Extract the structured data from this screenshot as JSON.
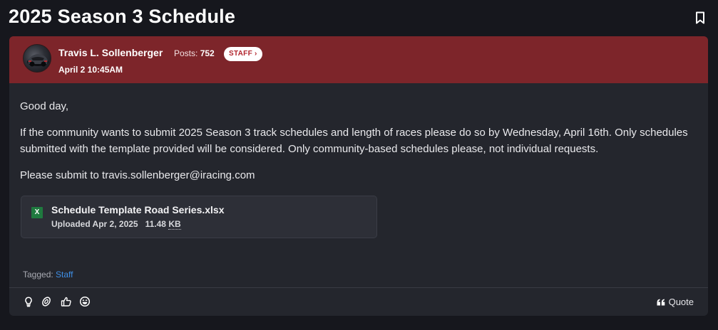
{
  "page": {
    "title": "2025 Season 3 Schedule"
  },
  "post": {
    "author": "Travis L. Sollenberger",
    "posts_label": "Posts:",
    "posts_count": "752",
    "badge": "STAFF ›",
    "date": "April 2 10:45AM",
    "body": [
      "Good day,",
      "If the community wants to submit 2025 Season 3 track schedules and length of races please do so by Wednesday, April 16th. Only schedules submitted with the template provided will be considered. Only community-based schedules please, not individual requests.",
      "Please submit to travis.sollenberger@iracing.com"
    ],
    "attachment": {
      "icon_glyph": "X",
      "file_name": "Schedule Template Road Series.xlsx",
      "uploaded": "Uploaded Apr 2, 2025",
      "size_value": "11.48",
      "size_unit": "KB"
    },
    "tagged_label": "Tagged:",
    "tag": "Staff"
  },
  "footer": {
    "reaction_icons": [
      "lightbulb-icon",
      "tire-icon",
      "thumbs-up-icon",
      "grin-icon"
    ],
    "quote_label": "Quote"
  },
  "colors": {
    "header_bg": "#7d252a",
    "card_bg": "#24262d",
    "page_bg": "#16171d",
    "link": "#3f8fe6",
    "badge_text": "#b1242c",
    "excel_green": "#1f7a3f"
  }
}
